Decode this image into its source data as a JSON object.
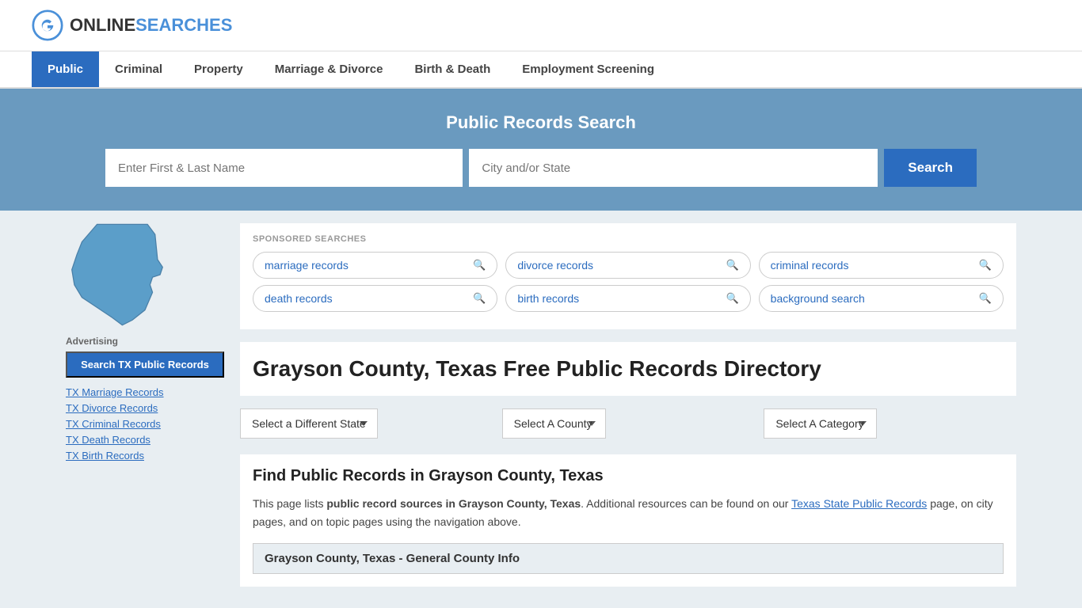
{
  "logo": {
    "text_online": "ONLINE",
    "text_searches": "SEARCHES",
    "icon_label": "G-circle-logo"
  },
  "nav": {
    "items": [
      {
        "label": "Public",
        "active": true
      },
      {
        "label": "Criminal",
        "active": false
      },
      {
        "label": "Property",
        "active": false
      },
      {
        "label": "Marriage & Divorce",
        "active": false
      },
      {
        "label": "Birth & Death",
        "active": false
      },
      {
        "label": "Employment Screening",
        "active": false
      }
    ]
  },
  "search_section": {
    "title": "Public Records Search",
    "name_placeholder": "Enter First & Last Name",
    "location_placeholder": "City and/or State",
    "button_label": "Search"
  },
  "sponsored": {
    "label": "SPONSORED SEARCHES",
    "tags": [
      {
        "label": "marriage records"
      },
      {
        "label": "divorce records"
      },
      {
        "label": "criminal records"
      },
      {
        "label": "death records"
      },
      {
        "label": "birth records"
      },
      {
        "label": "background search"
      }
    ]
  },
  "page": {
    "title": "Grayson County, Texas Free Public Records Directory",
    "state_dropdown_label": "Select a Different State",
    "county_dropdown_label": "Select A County",
    "category_dropdown_label": "Select A Category",
    "find_title": "Find Public Records in Grayson County, Texas",
    "find_desc_1": "This page lists ",
    "find_desc_bold": "public record sources in Grayson County, Texas",
    "find_desc_2": ". Additional resources can be found on our ",
    "find_desc_link": "Texas State Public Records",
    "find_desc_3": " page, on city pages, and on topic pages using the navigation above.",
    "county_info_heading": "Grayson County, Texas - General County Info"
  },
  "sidebar": {
    "ad_label": "Advertising",
    "ad_btn": "Search TX Public Records",
    "links": [
      {
        "label": "TX Marriage Records"
      },
      {
        "label": "TX Divorce Records"
      },
      {
        "label": "TX Criminal Records"
      },
      {
        "label": "TX Death Records"
      },
      {
        "label": "TX Birth Records"
      }
    ]
  },
  "colors": {
    "nav_active_bg": "#2b6cbf",
    "search_section_bg": "#6a9abf",
    "search_btn_bg": "#2b6cbf",
    "link_color": "#2b6cbf"
  }
}
